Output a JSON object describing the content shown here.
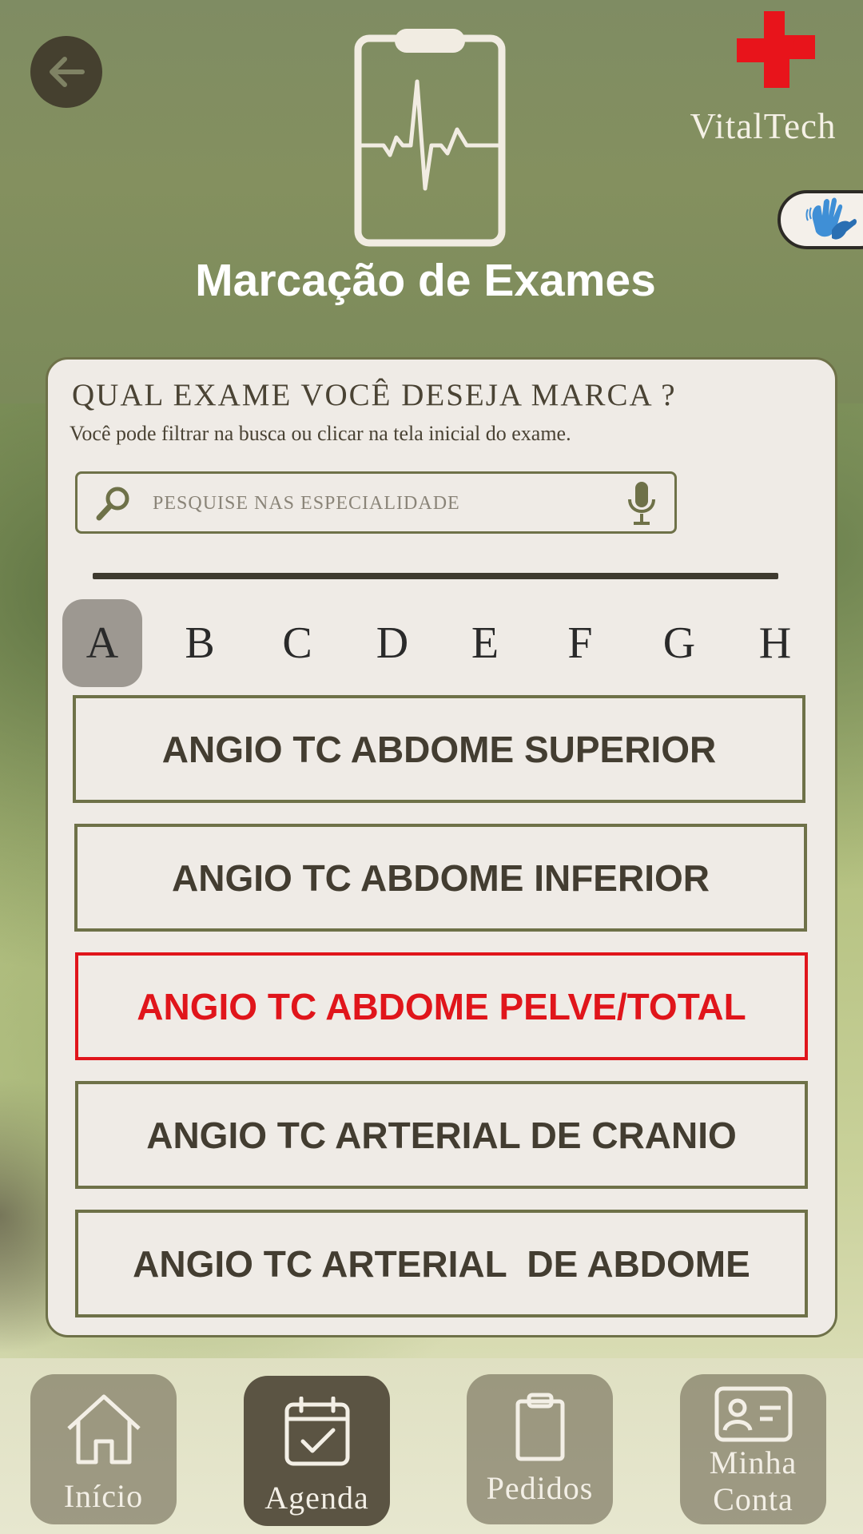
{
  "app": {
    "brand_name": "VitalTech",
    "page_title": "Marcação de Exames",
    "colors": {
      "header_green": "#7f8c63",
      "card_bg": "#efebe6",
      "border_olive": "#6e7148",
      "text_dark": "#433d31",
      "accent_red": "#e0151b",
      "nav_active": "#5b5443"
    }
  },
  "header": {
    "back_icon": "arrow-left-icon",
    "main_icon": "clipboard-heartbeat-icon",
    "logo_icon": "red-cross-icon",
    "accessibility_icon": "sign-language-hands-icon"
  },
  "card": {
    "question": "QUAL EXAME VOCÊ DESEJA MARCA ?",
    "hint": "Você pode filtrar na busca ou clicar na tela inicial do exame.",
    "search": {
      "placeholder": "PESQUISE NAS ESPECIALIDADE",
      "value": "",
      "search_icon": "search-icon",
      "mic_icon": "microphone-icon"
    },
    "letters": [
      "A",
      "B",
      "C",
      "D",
      "E",
      "F",
      "G",
      "H"
    ],
    "selected_letter": "A",
    "exams": [
      "ANGIO TC ABDOME SUPERIOR",
      "ANGIO TC ABDOME INFERIOR",
      "ANGIO TC ABDOME PELVE/TOTAL",
      "ANGIO TC ARTERIAL DE CRANIO",
      "ANGIO TC ARTERIAL  DE ABDOME"
    ],
    "selected_exam": "ANGIO TC ABDOME PELVE/TOTAL"
  },
  "nav": {
    "items": [
      {
        "label": "Início",
        "icon": "home-icon"
      },
      {
        "label": "Agenda",
        "icon": "calendar-check-icon"
      },
      {
        "label": "Pedidos",
        "icon": "clipboard-icon"
      },
      {
        "label": "Minha\nConta",
        "label_line1": "Minha",
        "label_line2": "Conta",
        "icon": "id-card-icon"
      }
    ],
    "active_index": 1
  }
}
